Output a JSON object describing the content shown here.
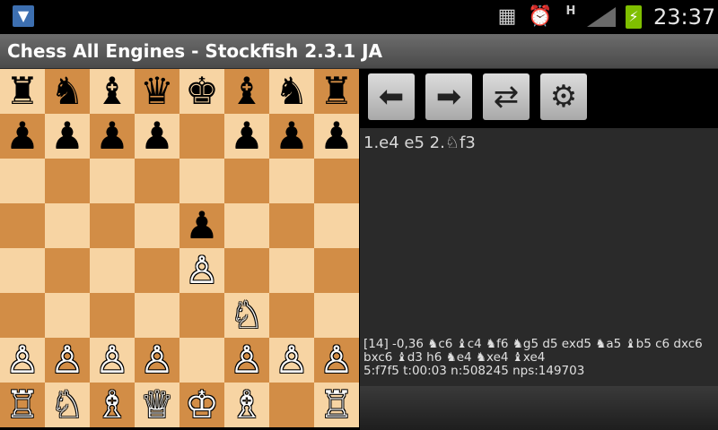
{
  "statusbar": {
    "usb_icon": "usb-icon",
    "network_type": "H",
    "time": "23:37"
  },
  "app": {
    "title": "Chess All Engines - Stockfish 2.3.1 JA"
  },
  "board": {
    "rows": [
      [
        "♜",
        "♞",
        "♝",
        "♛",
        "♚",
        "♝",
        "♞",
        "♜"
      ],
      [
        "♟",
        "♟",
        "♟",
        "♟",
        "",
        "♟",
        "♟",
        "♟"
      ],
      [
        "",
        "",
        "",
        "",
        "",
        "",
        "",
        ""
      ],
      [
        "",
        "",
        "",
        "",
        "♟",
        "",
        "",
        ""
      ],
      [
        "",
        "",
        "",
        "",
        "♙",
        "",
        "",
        ""
      ],
      [
        "",
        "",
        "",
        "",
        "",
        "♘",
        "",
        ""
      ],
      [
        "♙",
        "♙",
        "♙",
        "♙",
        "",
        "♙",
        "♙",
        "♙"
      ],
      [
        "♖",
        "♘",
        "♗",
        "♕",
        "♔",
        "♗",
        "",
        "♖"
      ]
    ],
    "light_color": "#f7d4a3",
    "dark_color": "#d28d46"
  },
  "toolbar": {
    "back_icon": "⬅",
    "forward_icon": "➡",
    "flip_icon": "⇄",
    "settings_icon": "⚙"
  },
  "moves": "1.e4 e5 2.♘f3",
  "analysis": {
    "line1": "[14] -0,36 ♞c6 ♝c4 ♞f6 ♞g5 d5 exd5 ♞a5 ♝b5 c6 dxc6",
    "line2": "bxc6 ♝d3 h6 ♞e4 ♞xe4 ♝xe4",
    "line3": "5:f7f5 t:00:03 n:508245 nps:149703"
  }
}
